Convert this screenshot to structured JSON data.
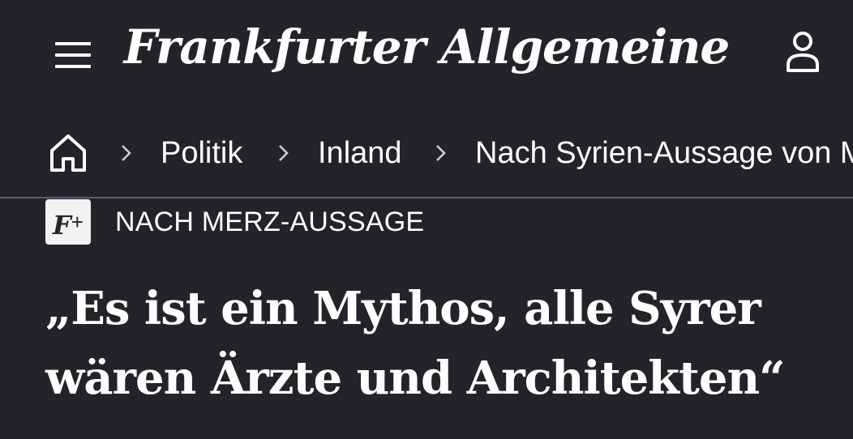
{
  "header": {
    "logo_text": "Frankfurter Allgemeine",
    "menu_icon": "hamburger-menu-icon",
    "account_icon": "user-account-icon"
  },
  "breadcrumb": {
    "home_icon": "home-icon",
    "separator_icon": "chevron-right-icon",
    "items": [
      {
        "label": "Politik"
      },
      {
        "label": "Inland"
      },
      {
        "label": "Nach Syrien-Aussage von M"
      }
    ]
  },
  "article": {
    "badge_text": "F+",
    "kicker": "NACH MERZ-AUSSAGE",
    "headline": "„Es ist ein Mythos, alle Syrer wären Ärzte und Architekten“"
  },
  "colors": {
    "background": "#222429",
    "text": "#ffffff",
    "divider": "#5c5f66",
    "badge_background": "#f2f2f2"
  }
}
